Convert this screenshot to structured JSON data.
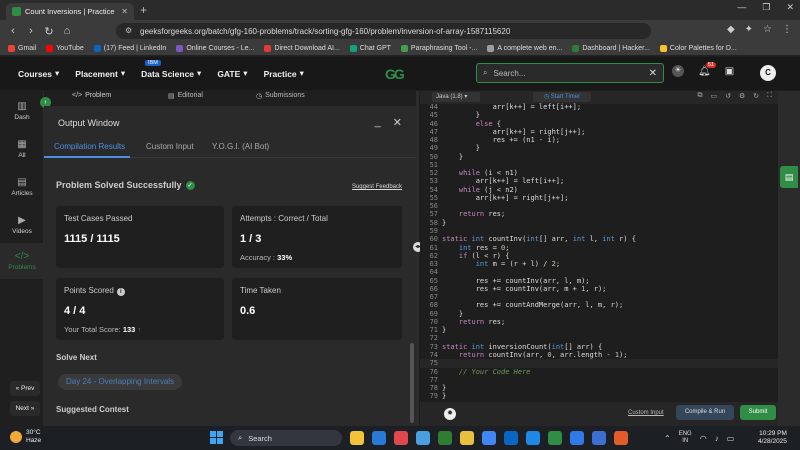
{
  "browser": {
    "tab_title": "Count Inversions | Practice | Ge",
    "url": "geeksforgeeks.org/batch/gfg-160-problems/track/sorting-gfg-160/problem/inversion-of-array-1587115620",
    "bookmarks": [
      {
        "label": "Gmail",
        "color": "#ea4335"
      },
      {
        "label": "YouTube",
        "color": "#ff0000"
      },
      {
        "label": "(17) Feed | LinkedIn",
        "color": "#0a66c2"
      },
      {
        "label": "Online Courses - Le...",
        "color": "#7e57c2"
      },
      {
        "label": "Direct Download AI...",
        "color": "#e53935"
      },
      {
        "label": "Chat GPT",
        "color": "#10a37f"
      },
      {
        "label": "Paraphrasing Tool -...",
        "color": "#43a047"
      },
      {
        "label": "A complete web en...",
        "color": "#9e9e9e"
      },
      {
        "label": "Dashboard | Hacker...",
        "color": "#2e7d32"
      },
      {
        "label": "Color Palettes for D...",
        "color": "#fbc02d"
      }
    ]
  },
  "header": {
    "menus": [
      "Courses",
      "Placement",
      "Data Science",
      "GATE",
      "Practice"
    ],
    "ibm_badge": "IBM",
    "logo": "GG",
    "search_placeholder": "Search...",
    "notification_count": "51",
    "avatar_letter": "C"
  },
  "rail": {
    "items": [
      {
        "label": "Dash",
        "icon": "▥"
      },
      {
        "label": "All",
        "icon": "▦"
      },
      {
        "label": "Articles",
        "icon": "▤"
      },
      {
        "label": "Videos",
        "icon": "▶"
      },
      {
        "label": "Problems",
        "icon": "</>"
      }
    ],
    "prev": "« Prev",
    "next": "Next »"
  },
  "problem_tabs": {
    "problem": "Problem",
    "editorial": "Editorial",
    "submissions": "Submissions"
  },
  "output": {
    "title": "Output Window",
    "tabs": [
      "Compilation Results",
      "Custom Input",
      "Y.O.G.I. (AI Bot)"
    ],
    "status": "Problem Solved Successfully",
    "feedback": "Suggest Feedback",
    "test_cases_label": "Test Cases Passed",
    "test_cases_value": "1115 / 1115",
    "attempts_label": "Attempts : Correct / Total",
    "attempts_value": "1 / 3",
    "accuracy_label": "Accuracy :",
    "accuracy_value": "33%",
    "points_label": "Points Scored",
    "points_value": "4 / 4",
    "total_score_label": "Your Total Score:",
    "total_score_value": "133",
    "time_label": "Time Taken",
    "time_value": "0.6",
    "solve_next_label": "Solve Next",
    "solve_next_item": "Day 24 - Overlapping Intervals",
    "suggested_label": "Suggested Contest"
  },
  "editor": {
    "language": "Java (1.8)",
    "timer": "Start Timer",
    "custom_input": "Custom Input",
    "compile_run": "Compile & Run",
    "submit": "Submit",
    "lines": [
      {
        "n": "44",
        "t": "            arr[k++] = left[i++];"
      },
      {
        "n": "45",
        "t": "        }"
      },
      {
        "n": "46",
        "t": "        else {"
      },
      {
        "n": "47",
        "t": "            arr[k++] = right[j++];"
      },
      {
        "n": "48",
        "t": "            res += (n1 - i);"
      },
      {
        "n": "49",
        "t": "        }"
      },
      {
        "n": "50",
        "t": "    }"
      },
      {
        "n": "51",
        "t": ""
      },
      {
        "n": "52",
        "t": "    while (i < n1)"
      },
      {
        "n": "53",
        "t": "        arr[k++] = left[i++];"
      },
      {
        "n": "54",
        "t": "    while (j < n2)"
      },
      {
        "n": "55",
        "t": "        arr[k++] = right[j++];"
      },
      {
        "n": "56",
        "t": ""
      },
      {
        "n": "57",
        "t": "    return res;"
      },
      {
        "n": "58",
        "t": "}"
      },
      {
        "n": "59",
        "t": ""
      },
      {
        "n": "60",
        "t": "static int countInv(int[] arr, int l, int r) {"
      },
      {
        "n": "61",
        "t": "    int res = 0;"
      },
      {
        "n": "62",
        "t": "    if (l < r) {"
      },
      {
        "n": "63",
        "t": "        int m = (r + l) / 2;"
      },
      {
        "n": "64",
        "t": ""
      },
      {
        "n": "65",
        "t": "        res += countInv(arr, l, m);"
      },
      {
        "n": "66",
        "t": "        res += countInv(arr, m + 1, r);"
      },
      {
        "n": "67",
        "t": ""
      },
      {
        "n": "68",
        "t": "        res += countAndMerge(arr, l, m, r);"
      },
      {
        "n": "69",
        "t": "    }"
      },
      {
        "n": "70",
        "t": "    return res;"
      },
      {
        "n": "71",
        "t": "}"
      },
      {
        "n": "72",
        "t": ""
      },
      {
        "n": "73",
        "t": "static int inversionCount(int[] arr) {"
      },
      {
        "n": "74",
        "t": "    return countInv(arr, 0, arr.length - 1);"
      },
      {
        "n": "75",
        "t": ""
      },
      {
        "n": "76",
        "t": "    // Your Code Here"
      },
      {
        "n": "77",
        "t": ""
      },
      {
        "n": "78",
        "t": "}"
      },
      {
        "n": "79",
        "t": "}"
      }
    ]
  },
  "taskbar": {
    "temp": "30°C",
    "weather": "Haze",
    "search": "Search",
    "lang_top": "ENG",
    "lang_bottom": "IN",
    "time": "10:29 PM",
    "date": "4/28/2025",
    "apps": [
      "#f2c23b",
      "#2b79d6",
      "#e0484d",
      "#4a9fe0",
      "#2e7d32",
      "#e8c03d",
      "#4285f4",
      "#0a66c2",
      "#1e88e5",
      "#2f8d46",
      "#3079e8",
      "#3b6fd1",
      "#e35a2b"
    ]
  },
  "colors": {
    "accent": "#2f8d46",
    "link": "#4a90e2"
  }
}
